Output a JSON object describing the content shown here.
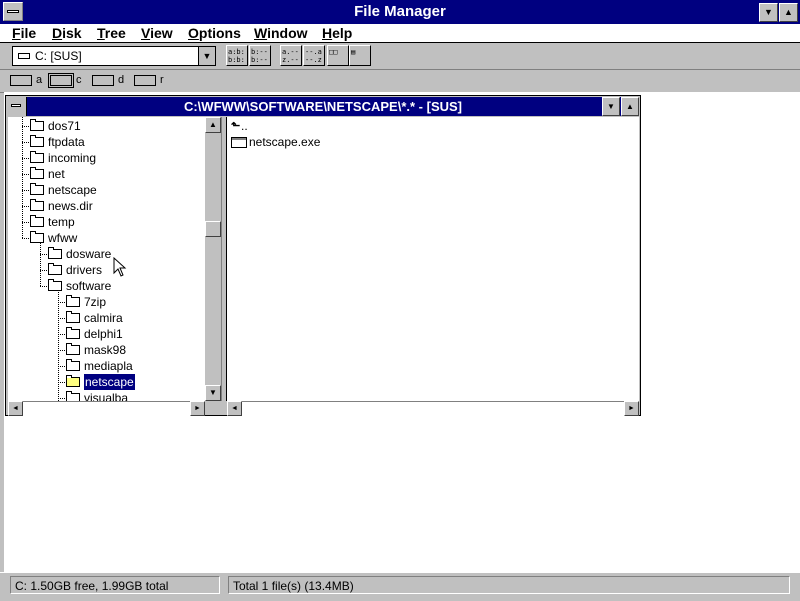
{
  "app": {
    "title": "File Manager"
  },
  "menu": [
    {
      "label": "File",
      "key": "F",
      "rest": "ile"
    },
    {
      "label": "Disk",
      "key": "D",
      "rest": "isk"
    },
    {
      "label": "Tree",
      "key": "T",
      "rest": "ree"
    },
    {
      "label": "View",
      "key": "V",
      "rest": "iew"
    },
    {
      "label": "Options",
      "key": "O",
      "rest": "ptions"
    },
    {
      "label": "Window",
      "key": "W",
      "rest": "indow"
    },
    {
      "label": "Help",
      "key": "H",
      "rest": "elp"
    }
  ],
  "toolbar": {
    "drive_selector": "C: [SUS]",
    "buttons": [
      {
        "name": "view-large-icons",
        "glyph": "a:b:\nb:b:"
      },
      {
        "name": "view-details",
        "glyph": "b:--\nb:--"
      },
      {
        "name": "sort-by-name",
        "glyph": "a.--\nz.--"
      },
      {
        "name": "sort-by-type",
        "glyph": "--.a\n--.z"
      },
      {
        "name": "window-new",
        "glyph": "□□"
      },
      {
        "name": "window-options",
        "glyph": "▤"
      }
    ]
  },
  "drives": [
    {
      "letter": "a",
      "type": "floppy"
    },
    {
      "letter": "c",
      "type": "hard",
      "selected": true
    },
    {
      "letter": "d",
      "type": "cdrom"
    },
    {
      "letter": "r",
      "type": "ram"
    }
  ],
  "child_window": {
    "title": "C:\\WFWW\\SOFTWARE\\NETSCAPE\\*.* - [SUS]"
  },
  "tree": [
    {
      "name": "dos71",
      "depth": 0
    },
    {
      "name": "ftpdata",
      "depth": 0
    },
    {
      "name": "incoming",
      "depth": 0
    },
    {
      "name": "net",
      "depth": 0
    },
    {
      "name": "netscape",
      "depth": 0
    },
    {
      "name": "news.dir",
      "depth": 0
    },
    {
      "name": "temp",
      "depth": 0
    },
    {
      "name": "wfww",
      "depth": 0
    },
    {
      "name": "dosware",
      "depth": 1
    },
    {
      "name": "drivers",
      "depth": 1
    },
    {
      "name": "software",
      "depth": 1
    },
    {
      "name": "7zip",
      "depth": 2
    },
    {
      "name": "calmira",
      "depth": 2
    },
    {
      "name": "delphi1",
      "depth": 2
    },
    {
      "name": "mask98",
      "depth": 2
    },
    {
      "name": "mediapla",
      "depth": 2
    },
    {
      "name": "netscape",
      "depth": 2,
      "selected": true
    },
    {
      "name": "visualba",
      "depth": 2
    }
  ],
  "files": [
    {
      "name": "..",
      "icon": "up-arrow-icon"
    },
    {
      "name": "netscape.exe",
      "icon": "exe-icon"
    }
  ],
  "status": {
    "free": "C: 1.50GB free,  1.99GB total",
    "total": "Total 1 file(s) (13.4MB)"
  },
  "colors": {
    "title_bar": "#000080",
    "window_face": "#c0c0c0",
    "selection": "#000080"
  }
}
